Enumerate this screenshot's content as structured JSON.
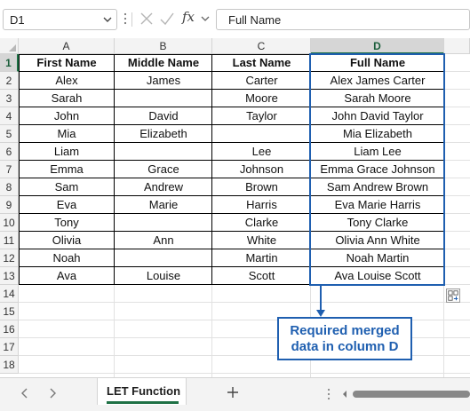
{
  "formula_bar": {
    "name_box": "D1",
    "fx_label": "fx",
    "formula": "Full Name"
  },
  "columns": [
    "A",
    "B",
    "C",
    "D"
  ],
  "rows": [
    "1",
    "2",
    "3",
    "4",
    "5",
    "6",
    "7",
    "8",
    "9",
    "10",
    "11",
    "12",
    "13",
    "14",
    "15",
    "16",
    "17",
    "18"
  ],
  "selected_cell": "D1",
  "table": {
    "headers": [
      "First Name",
      "Middle Name",
      "Last Name",
      "Full Name"
    ],
    "data": [
      [
        "Alex",
        "James",
        "Carter",
        "Alex James Carter"
      ],
      [
        "Sarah",
        "",
        "Moore",
        "Sarah Moore"
      ],
      [
        "John",
        "David",
        "Taylor",
        "John David Taylor"
      ],
      [
        "Mia",
        "Elizabeth",
        "",
        "Mia Elizabeth"
      ],
      [
        "Liam",
        "",
        "Lee",
        "Liam Lee"
      ],
      [
        "Emma",
        "Grace",
        "Johnson",
        "Emma Grace Johnson"
      ],
      [
        "Sam",
        "Andrew",
        "Brown",
        "Sam Andrew Brown"
      ],
      [
        "Eva",
        "Marie",
        "Harris",
        "Eva Marie Harris"
      ],
      [
        "Tony",
        "",
        "Clarke",
        "Tony Clarke"
      ],
      [
        "Olivia",
        "Ann",
        "White",
        "Olivia Ann White"
      ],
      [
        "Noah",
        "",
        "Martin",
        "Noah Martin"
      ],
      [
        "Ava",
        "Louise",
        "Scott",
        "Ava Louise Scott"
      ]
    ]
  },
  "callout": {
    "line1": "Required merged",
    "line2": "data in column D"
  },
  "sheet_tabs": {
    "active": "LET Function",
    "add_label": "+"
  },
  "colors": {
    "accent_green": "#1f7145",
    "selection_blue": "#1f5fb0",
    "header_bg": "#f3f3f3"
  },
  "icons": [
    "chevron-down-icon",
    "cancel-icon",
    "confirm-icon",
    "insert-function-icon",
    "scroll-left-icon",
    "scroll-right-icon",
    "add-sheet-icon",
    "quick-analysis-icon"
  ]
}
